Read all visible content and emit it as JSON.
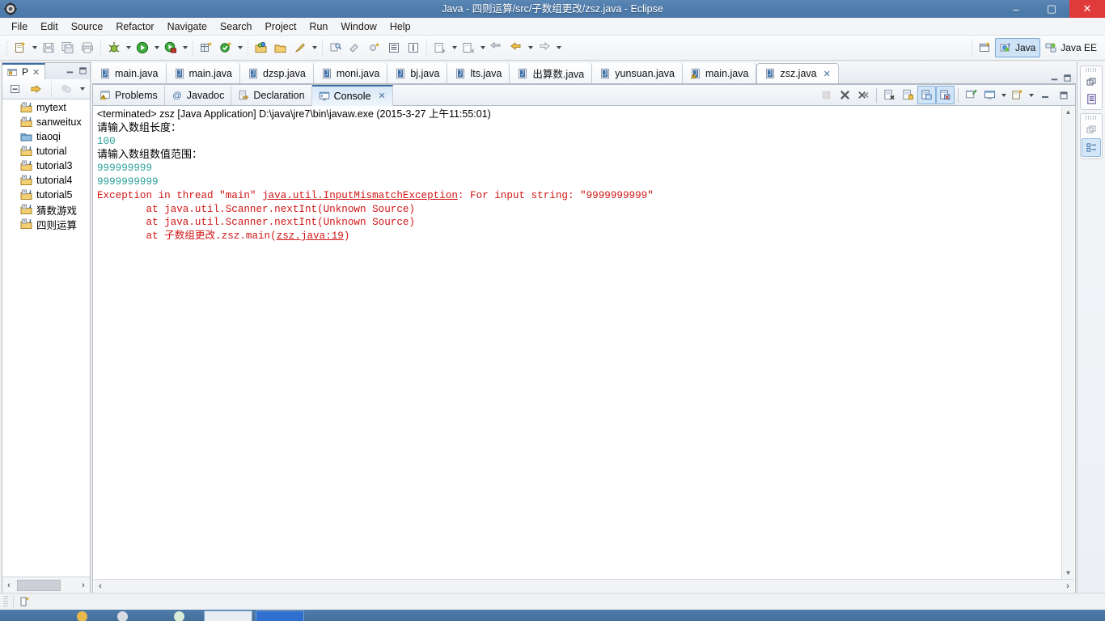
{
  "window": {
    "title": "Java - 四则运算/src/子数组更改/zsz.java - Eclipse",
    "app_icon": "eclipse-icon",
    "minimize": "–",
    "maximize": "▢",
    "close": "✕",
    "titlebar_color": "#4f7cab"
  },
  "menubar": {
    "items": [
      {
        "label": "File"
      },
      {
        "label": "Edit"
      },
      {
        "label": "Source"
      },
      {
        "label": "Refactor"
      },
      {
        "label": "Navigate"
      },
      {
        "label": "Search"
      },
      {
        "label": "Project"
      },
      {
        "label": "Run"
      },
      {
        "label": "Window"
      },
      {
        "label": "Help"
      }
    ]
  },
  "toolbar": {
    "groups": [
      {
        "buttons": [
          {
            "icon": "new-wizard-icon",
            "has_arrow": true
          },
          {
            "icon": "save-icon",
            "has_arrow": false
          },
          {
            "icon": "save-all-icon",
            "has_arrow": false
          },
          {
            "icon": "print-icon",
            "has_arrow": false
          }
        ]
      },
      {
        "buttons": [
          {
            "icon": "debug-icon",
            "has_arrow": true
          },
          {
            "icon": "run-icon",
            "has_arrow": true
          },
          {
            "icon": "run-external-tools-icon",
            "has_arrow": true
          }
        ]
      },
      {
        "buttons": [
          {
            "icon": "new-java-project-icon",
            "has_arrow": false
          },
          {
            "icon": "new-java-class-icon",
            "has_arrow": true
          }
        ]
      },
      {
        "buttons": [
          {
            "icon": "open-type-icon",
            "has_arrow": false
          },
          {
            "icon": "open-task-icon",
            "has_arrow": false
          },
          {
            "icon": "quick-fix-icon",
            "has_arrow": true
          }
        ]
      },
      {
        "buttons": [
          {
            "icon": "search-icon",
            "has_arrow": false
          },
          {
            "icon": "link-editor-icon",
            "has_arrow": false
          },
          {
            "icon": "toggle-mark-icon",
            "has_arrow": false
          },
          {
            "icon": "show-whitespace-icon",
            "has_arrow": false
          },
          {
            "icon": "block-selection-icon",
            "has_arrow": false
          }
        ]
      },
      {
        "buttons": [
          {
            "icon": "next-annotation-icon",
            "has_arrow": true
          },
          {
            "icon": "previous-annotation-icon",
            "has_arrow": true
          },
          {
            "icon": "last-edit-location-icon",
            "has_arrow": false
          },
          {
            "icon": "back-icon",
            "has_arrow": true
          },
          {
            "icon": "forward-icon",
            "has_arrow": true
          }
        ]
      }
    ],
    "perspectives": {
      "open_perspective_icon": "open-perspective-icon",
      "items": [
        {
          "label": "Java",
          "icon": "java-perspective-icon",
          "active": true
        },
        {
          "label": "Java EE",
          "icon": "javaee-perspective-icon",
          "active": false
        }
      ]
    }
  },
  "package_explorer": {
    "tab_label": "P",
    "tab_icon": "package-explorer-icon",
    "close_icon": "close-icon",
    "minimize_icon": "minimize-icon",
    "maximize_icon": "maximize-icon",
    "toolbar": [
      {
        "icon": "collapse-all-icon"
      },
      {
        "icon": "link-with-editor-icon"
      },
      {
        "icon": "view-filter-icon"
      },
      {
        "icon": "view-menu-icon"
      }
    ],
    "items": [
      {
        "label": "mytext",
        "icon": "java-project-icon"
      },
      {
        "label": "sanweitux",
        "icon": "java-project-icon"
      },
      {
        "label": "tiaoqi",
        "icon": "folder-project-icon"
      },
      {
        "label": "tutorial",
        "icon": "java-project-icon"
      },
      {
        "label": "tutorial3",
        "icon": "java-project-icon"
      },
      {
        "label": "tutorial4",
        "icon": "java-project-icon"
      },
      {
        "label": "tutorial5",
        "icon": "java-project-icon"
      },
      {
        "label": "猜数游戏",
        "icon": "java-project-icon"
      },
      {
        "label": "四则运算",
        "icon": "java-project-icon"
      }
    ],
    "hscroll": {
      "left_arrow": "‹",
      "right_arrow": "›"
    }
  },
  "editor_tabs": {
    "items": [
      {
        "label": "main.java",
        "icon": "java-file-icon",
        "active": false,
        "closable": false
      },
      {
        "label": "main.java",
        "icon": "java-file-icon",
        "active": false,
        "closable": false
      },
      {
        "label": "dzsp.java",
        "icon": "java-file-icon",
        "active": false,
        "closable": false
      },
      {
        "label": "moni.java",
        "icon": "java-file-icon",
        "active": false,
        "closable": false
      },
      {
        "label": "bj.java",
        "icon": "java-file-icon",
        "active": false,
        "closable": false
      },
      {
        "label": "lts.java",
        "icon": "java-file-icon",
        "active": false,
        "closable": false
      },
      {
        "label": "出算数.java",
        "icon": "java-file-icon",
        "active": false,
        "closable": false
      },
      {
        "label": "yunsuan.java",
        "icon": "java-file-icon",
        "active": false,
        "closable": false
      },
      {
        "label": "main.java",
        "icon": "java-file-warning-icon",
        "active": false,
        "closable": false
      },
      {
        "label": "zsz.java",
        "icon": "java-file-icon",
        "active": true,
        "closable": true
      }
    ],
    "close_icon": "close-icon",
    "minimize_icon": "minimize-icon",
    "maximize_icon": "maximize-icon"
  },
  "view_tabs": {
    "items": [
      {
        "label": "Problems",
        "icon": "problems-icon",
        "active": false,
        "closable": false
      },
      {
        "label": "Javadoc",
        "icon": "javadoc-icon",
        "active": false,
        "closable": false
      },
      {
        "label": "Declaration",
        "icon": "declaration-icon",
        "active": false,
        "closable": false
      },
      {
        "label": "Console",
        "icon": "console-icon",
        "active": true,
        "closable": true
      }
    ],
    "close_icon": "close-icon",
    "toolbar": [
      {
        "icon": "terminate-icon",
        "enabled": false,
        "toggled": false
      },
      {
        "icon": "remove-launch-icon",
        "enabled": true,
        "toggled": false
      },
      {
        "icon": "remove-all-launches-icon",
        "enabled": true,
        "toggled": false
      },
      {
        "icon": "clear-console-icon",
        "enabled": true,
        "toggled": false
      },
      {
        "icon": "scroll-lock-icon",
        "enabled": true,
        "toggled": false
      },
      {
        "icon": "show-console-on-output-icon",
        "enabled": true,
        "toggled": true
      },
      {
        "icon": "show-console-on-error-icon",
        "enabled": true,
        "toggled": true
      },
      {
        "icon": "pin-console-icon",
        "enabled": true,
        "toggled": false
      },
      {
        "icon": "display-selected-console-icon",
        "enabled": true,
        "toggled": false,
        "has_arrow": true
      },
      {
        "icon": "open-console-icon",
        "enabled": true,
        "toggled": false,
        "has_arrow": true
      },
      {
        "icon": "minimize-icon",
        "enabled": true,
        "toggled": false
      },
      {
        "icon": "maximize-icon",
        "enabled": true,
        "toggled": false
      }
    ]
  },
  "console": {
    "lines": [
      {
        "text": "<terminated> zsz [Java Application] D:\\java\\jre7\\bin\\javaw.exe (2015-3-27 上午11:55:01)",
        "style": "header"
      },
      {
        "text": "请输入数组长度：",
        "style": "prompt"
      },
      {
        "text": "100",
        "style": "input"
      },
      {
        "text": "请输入数组数值范围：",
        "style": "prompt"
      },
      {
        "text": "999999999",
        "style": "input"
      },
      {
        "text": "9999999999",
        "style": "input"
      },
      {
        "text": "Exception in thread \"main\" java.util.InputMismatchException: For input string: \"9999999999\"",
        "style": "error",
        "link": "java.util.InputMismatchException"
      },
      {
        "text": "        at java.util.Scanner.nextInt(Unknown Source)",
        "style": "error"
      },
      {
        "text": "        at java.util.Scanner.nextInt(Unknown Source)",
        "style": "error"
      },
      {
        "text": "        at 子数组更改.zsz.main(zsz.java:19)",
        "style": "error",
        "link": "zsz.java:19"
      }
    ],
    "colors": {
      "input": "#2aa198",
      "error": "#d01414",
      "text": "#000000"
    },
    "vscroll": {
      "up_arrow": "▲",
      "down_arrow": "▼"
    },
    "hscroll": {
      "left_arrow": "‹",
      "right_arrow": "›"
    }
  },
  "right_bar": {
    "stacks": [
      {
        "buttons": [
          {
            "icon": "restore-icon"
          },
          {
            "icon": "outline-icon"
          }
        ]
      },
      {
        "buttons": [
          {
            "icon": "restore-icon"
          },
          {
            "icon": "task-list-icon",
            "selected": true
          }
        ]
      }
    ]
  },
  "status_bar": {
    "icon": "editor-state-icon",
    "text": ""
  },
  "taskbar": {
    "items": [
      "app-1",
      "app-2",
      "app-3",
      "eclipse-window",
      "active-window"
    ]
  }
}
